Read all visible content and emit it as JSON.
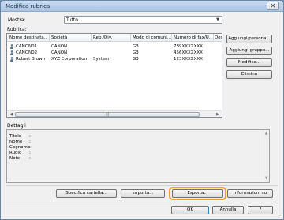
{
  "window": {
    "title": "Modifica rubrica",
    "close_glyph": "✕"
  },
  "filter": {
    "label": "Mostra:",
    "selected": "Tutto",
    "arrow": "▼"
  },
  "list": {
    "label": "Rubrica:",
    "columns": [
      "Nome destinata...",
      "Società",
      "Rep./Div.",
      "Modo di comuni...",
      "Numero di fax/U...",
      "Des"
    ],
    "rows": [
      {
        "name": "CANON01",
        "company": "CANON",
        "division": "",
        "mode": "G3",
        "number": "789XXXXXXX"
      },
      {
        "name": "CANON02",
        "company": "CANON",
        "division": "",
        "mode": "G3",
        "number": "456XXXXXXX"
      },
      {
        "name": "Robert Brown",
        "company": "XYZ Corporation",
        "division": "System",
        "mode": "G3",
        "number": "123XXXXXXX"
      }
    ],
    "scroll_left": "◀",
    "scroll_right": "▶",
    "thumb_grip": "|||"
  },
  "side_buttons": {
    "add_person": "Aggiungi persona...",
    "add_group": "Aggiungi gruppo...",
    "edit": "Modifica...",
    "delete": "Elimina"
  },
  "details": {
    "label": "Dettagli",
    "fields": [
      "Titolo",
      "Nome",
      "Cognome",
      "Ruolo",
      "Note"
    ],
    "colon": ":",
    "scroll_up": "▲",
    "scroll_down": "▼"
  },
  "bottom_buttons": {
    "specify_folder": "Specifica cartella...",
    "import": "Importa...",
    "export": "Esporta...",
    "info": "Informazioni su"
  },
  "dialog_buttons": {
    "ok": "OK",
    "cancel": "Annulla",
    "help": "?"
  },
  "icons": {
    "person": "person-icon",
    "close": "close-icon"
  },
  "colors": {
    "accent_highlight": "#f0a030",
    "title_bar": "#b9d1ea"
  }
}
